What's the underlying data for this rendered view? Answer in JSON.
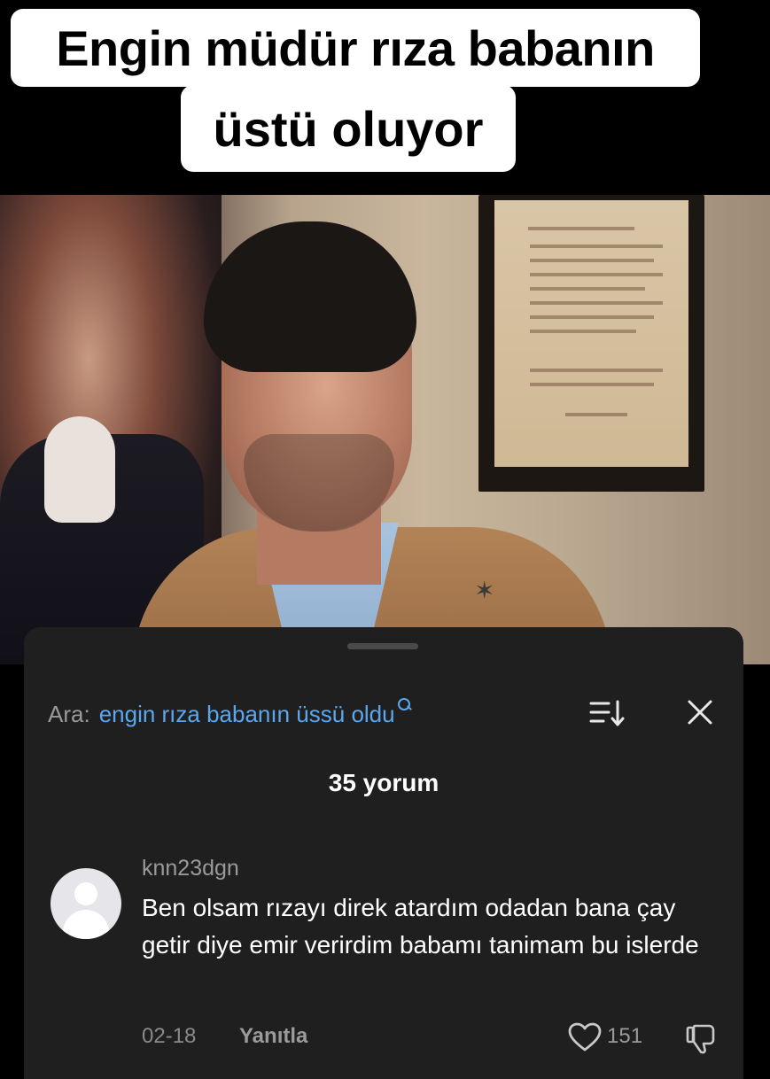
{
  "caption": {
    "line1": "Engin müdür rıza babanın",
    "line2": "üstü oluyor"
  },
  "video": {
    "pin_icon": "star-pin-icon"
  },
  "comments_sheet": {
    "search": {
      "label": "Ara:",
      "query": "engin rıza babanın üssü oldu"
    },
    "icons": {
      "search": "search-icon",
      "sort": "sort-icon",
      "close": "close-icon"
    },
    "count_text": "35 yorum",
    "comments": [
      {
        "username": "knn23dgn",
        "text": "Ben olsam rızayı direk atardım odadan bana çay getir diye emir verirdim babamı tanimam bu islerde",
        "date": "02-18",
        "reply_label": "Yanıtla",
        "likes": "151"
      }
    ],
    "colors": {
      "sheet_bg": "#1f1f1f",
      "query_blue": "#5aa7ef",
      "muted": "#9a9a9a"
    }
  }
}
